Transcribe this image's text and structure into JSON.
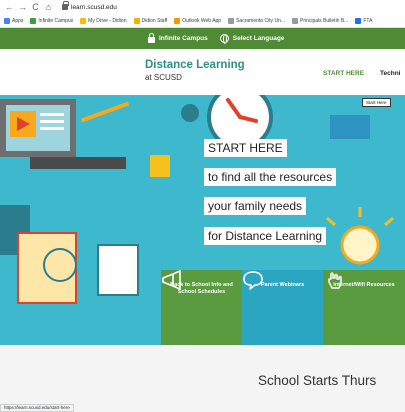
{
  "browser": {
    "url": "learn.scusd.edu",
    "bookmarks": [
      {
        "label": "Apps",
        "color": "#4285f4"
      },
      {
        "label": "Infinite Campus",
        "color": "#3f9b3f"
      },
      {
        "label": "My Drive - Didion",
        "color": "#fbbc05"
      },
      {
        "label": "Didion Staff",
        "color": "#f4b400"
      },
      {
        "label": "Outlook Web App",
        "color": "#f09a00"
      },
      {
        "label": "Sacramento City Un...",
        "color": "#9a9a9a"
      },
      {
        "label": "Principals Bulletin B...",
        "color": "#9a9a9a"
      },
      {
        "label": "FTA",
        "color": "#1a73e8"
      }
    ],
    "status_url": "https://learn.scusd.edu/start-here"
  },
  "topbar": {
    "infinite_campus": "Infinite Campus",
    "select_language": "Select Language"
  },
  "header": {
    "title": "Distance Learning",
    "subtitle": "at SCUSD",
    "nav_start": "START HERE",
    "nav_tech": "Techni"
  },
  "hero": {
    "start_here_button": "Start Here",
    "lines": [
      "START HERE",
      "to find all the resources",
      "your family needs",
      "for Distance Learning"
    ]
  },
  "tiles": [
    {
      "label": "Back to School Info and School Schedules",
      "icon": "megaphone-icon"
    },
    {
      "label": "Parent Webinars",
      "icon": "speech-bubble-icon"
    },
    {
      "label": "Internet/Wifi Resources",
      "icon": "hand-pointer-icon"
    }
  ],
  "school_starts": "School Starts Thurs",
  "colors": {
    "green": "#4f8b35",
    "teal": "#3db8cc",
    "tile_green": "#5a9b3f",
    "tile_blue": "#2aa6c1",
    "brand": "#2e8f86"
  }
}
